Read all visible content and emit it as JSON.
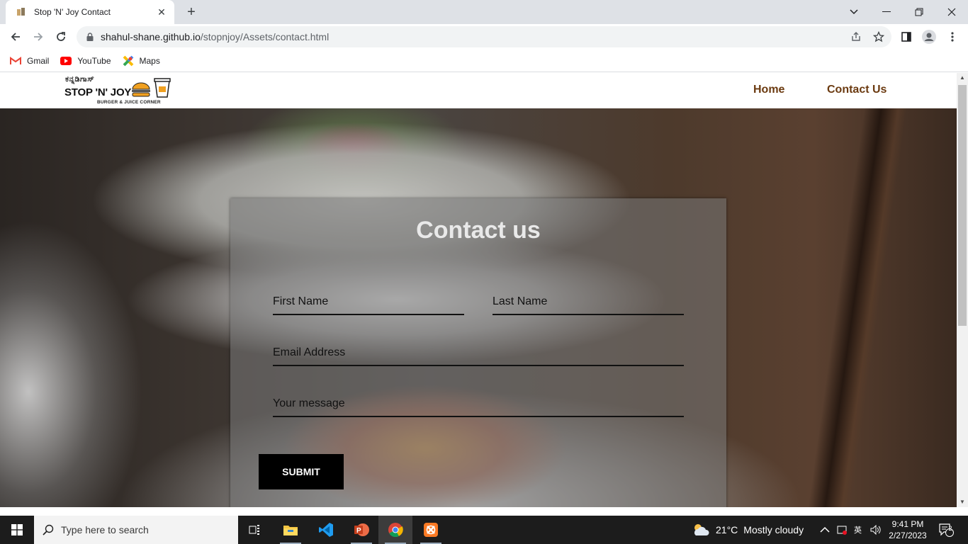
{
  "browser": {
    "tab_title": "Stop 'N' Joy Contact",
    "url_host": "shahul-shane.github.io",
    "url_path": "/stopnjoy/Assets/contact.html",
    "bookmarks": [
      {
        "label": "Gmail",
        "icon": "gmail-icon"
      },
      {
        "label": "YouTube",
        "icon": "youtube-icon"
      },
      {
        "label": "Maps",
        "icon": "maps-icon"
      }
    ]
  },
  "site": {
    "logo": {
      "kannada_text": "ಕನ್ನಡಿಗಾಸ್",
      "brand": "STOP 'N' JOY",
      "tagline": "BURGER & JUICE CORNER"
    },
    "nav": {
      "home": "Home",
      "contact": "Contact Us"
    }
  },
  "contact_form": {
    "title": "Contact us",
    "first_name_placeholder": "First Name",
    "last_name_placeholder": "Last Name",
    "email_placeholder": "Email Address",
    "message_placeholder": "Your message",
    "submit_label": "SUBMIT"
  },
  "taskbar": {
    "search_placeholder": "Type here to search",
    "weather_temp": "21°C",
    "weather_desc": "Mostly cloudy",
    "time": "9:41 PM",
    "date": "2/27/2023",
    "notification_count": "2"
  },
  "colors": {
    "nav_link": "#6b3a10",
    "submit_bg": "#000000",
    "card_overlay": "rgba(120,120,120,0.55)"
  }
}
